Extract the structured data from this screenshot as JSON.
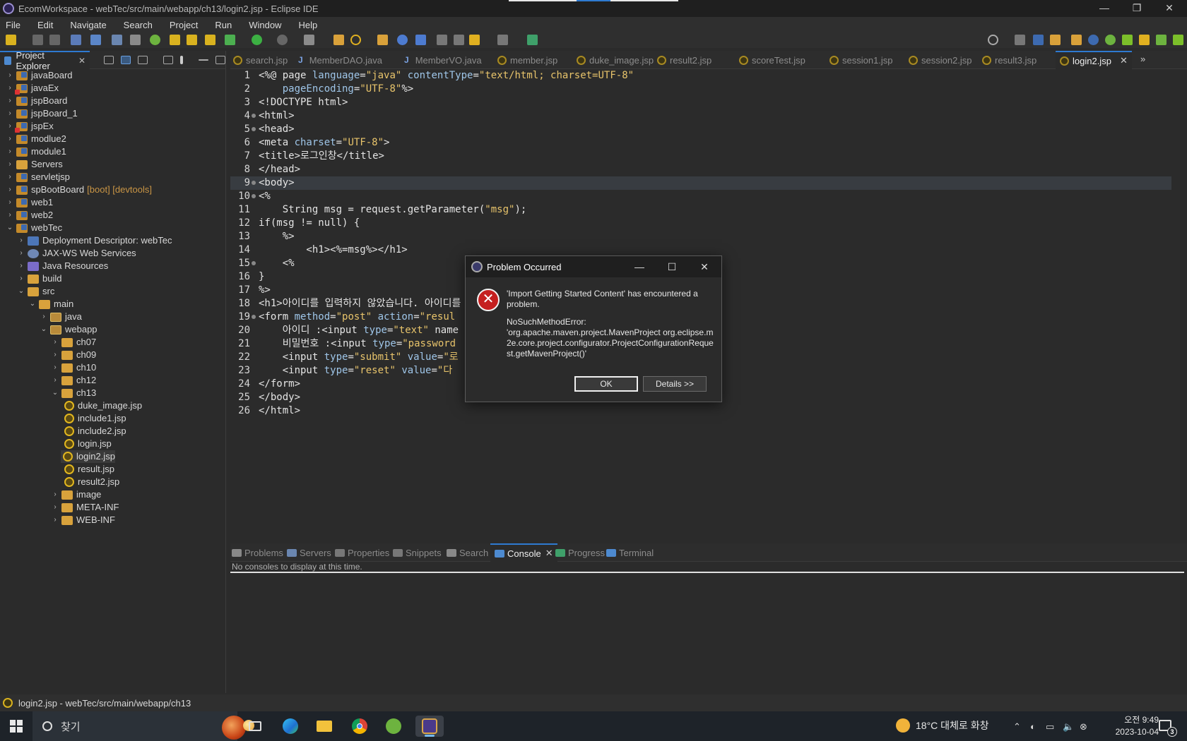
{
  "window": {
    "title": "EcomWorkspace - webTec/src/main/webapp/ch13/login2.jsp - Eclipse IDE",
    "minimize": "—",
    "restore": "❐",
    "close": "✕"
  },
  "menu": [
    "File",
    "Edit",
    "Navigate",
    "Search",
    "Project",
    "Run",
    "Window",
    "Help"
  ],
  "project_explorer": {
    "tab_label": "Project Explorer",
    "tree": [
      {
        "label": "javaBoard",
        "type": "project",
        "expanded": false
      },
      {
        "label": "javaEx",
        "type": "project",
        "expanded": false,
        "error": true
      },
      {
        "label": "jspBoard",
        "type": "project",
        "expanded": false
      },
      {
        "label": "jspBoard_1",
        "type": "project",
        "expanded": false
      },
      {
        "label": "jspEx",
        "type": "project",
        "expanded": false,
        "error": true
      },
      {
        "label": "modlue2",
        "type": "project",
        "expanded": false
      },
      {
        "label": "module1",
        "type": "project",
        "expanded": false
      },
      {
        "label": "Servers",
        "type": "folder",
        "expanded": false
      },
      {
        "label": "servletjsp",
        "type": "project",
        "expanded": false
      },
      {
        "label": "spBootBoard",
        "type": "project",
        "expanded": false,
        "decoration": "[boot] [devtools]"
      },
      {
        "label": "web1",
        "type": "project",
        "expanded": false
      },
      {
        "label": "web2",
        "type": "project",
        "expanded": false
      },
      {
        "label": "webTec",
        "type": "project",
        "expanded": true
      },
      {
        "label": "Deployment Descriptor: webTec",
        "type": "dd",
        "expanded": false
      },
      {
        "label": "JAX-WS Web Services",
        "type": "jaxws",
        "expanded": false
      },
      {
        "label": "Java Resources",
        "type": "jres",
        "expanded": false
      },
      {
        "label": "build",
        "type": "folder",
        "expanded": false
      },
      {
        "label": "src",
        "type": "folder",
        "expanded": true
      },
      {
        "label": "main",
        "type": "folder",
        "expanded": true
      },
      {
        "label": "java",
        "type": "pkg",
        "expanded": false
      },
      {
        "label": "webapp",
        "type": "pkg",
        "expanded": true
      },
      {
        "label": "ch07",
        "type": "folder",
        "expanded": false
      },
      {
        "label": "ch09",
        "type": "folder",
        "expanded": false
      },
      {
        "label": "ch10",
        "type": "folder",
        "expanded": false
      },
      {
        "label": "ch12",
        "type": "folder",
        "expanded": false
      },
      {
        "label": "ch13",
        "type": "folder",
        "expanded": true
      },
      {
        "label": "duke_image.jsp",
        "type": "jsp"
      },
      {
        "label": "include1.jsp",
        "type": "jsp"
      },
      {
        "label": "include2.jsp",
        "type": "jsp"
      },
      {
        "label": "login.jsp",
        "type": "jsp"
      },
      {
        "label": "login2.jsp",
        "type": "jsp",
        "selected": true
      },
      {
        "label": "result.jsp",
        "type": "jsp"
      },
      {
        "label": "result2.jsp",
        "type": "jsp"
      },
      {
        "label": "image",
        "type": "folder",
        "expanded": false
      },
      {
        "label": "META-INF",
        "type": "folder",
        "expanded": false
      },
      {
        "label": "WEB-INF",
        "type": "folder",
        "expanded": false
      }
    ]
  },
  "editor_tabs": [
    {
      "label": "search.jsp",
      "kind": "jsp"
    },
    {
      "label": "MemberDAO.java",
      "kind": "java"
    },
    {
      "label": "MemberVO.java",
      "kind": "java"
    },
    {
      "label": "member.jsp",
      "kind": "jsp"
    },
    {
      "label": "duke_image.jsp",
      "kind": "jsp"
    },
    {
      "label": "result2.jsp",
      "kind": "jsp"
    },
    {
      "label": "scoreTest.jsp",
      "kind": "jsp"
    },
    {
      "label": "session1.jsp",
      "kind": "jsp"
    },
    {
      "label": "session2.jsp",
      "kind": "jsp"
    },
    {
      "label": "result3.jsp",
      "kind": "jsp"
    },
    {
      "label": "login2.jsp",
      "kind": "jsp",
      "active": true
    }
  ],
  "code_lines": [
    "<%@ page language=\"java\" contentType=\"text/html; charset=UTF-8\"",
    "    pageEncoding=\"UTF-8\"%>",
    "<!DOCTYPE html>",
    "<html>",
    "<head>",
    "<meta charset=\"UTF-8\">",
    "<title>로그인창</title>",
    "</head>",
    "<body>",
    "<%",
    "    String msg = request.getParameter(\"msg\");",
    "if(msg != null) {",
    "    %>",
    "        <h1><%=msg%></h1>",
    "    <%",
    "}",
    "%>",
    "<h1>아이디를 입력하지 않았습니다. 아이디를 입",
    "<form method=\"post\" action=\"resul",
    "    아이디 :<input type=\"text\" name",
    "    비밀번호 :<input type=\"password",
    "    <input type=\"submit\" value=\"로",
    "    <input type=\"reset\" value=\"다",
    "</form>",
    "</body>",
    "</html>"
  ],
  "current_line": 9,
  "bottom_tabs": [
    "Problems",
    "Servers",
    "Properties",
    "Snippets",
    "Search",
    "Console",
    "Progress",
    "Terminal"
  ],
  "active_bottom_tab": "Console",
  "console": {
    "message": "No consoles to display at this time."
  },
  "status": {
    "path": "login2.jsp - webTec/src/main/webapp/ch13"
  },
  "dialog": {
    "title": "Problem Occurred",
    "message": "'Import Getting Started Content' has encountered a problem.",
    "detail": "NoSuchMethodError:\n'org.apache.maven.project.MavenProject org.eclipse.m2e.core.project.configurator.ProjectConfigurationRequest.getMavenProject()'",
    "ok_label": "OK",
    "details_label": "Details >>",
    "min": "—",
    "max": "☐",
    "close": "✕"
  },
  "taskbar": {
    "search_placeholder": "찾기",
    "weather": "18°C 대체로 화창",
    "time": "오전 9:49",
    "date": "2023-10-04",
    "notification_count": "3"
  },
  "colors": {
    "accent": "#2e7ad1",
    "error": "#c52020",
    "string": "#e8c46b",
    "attribute": "#9fc6e9"
  }
}
